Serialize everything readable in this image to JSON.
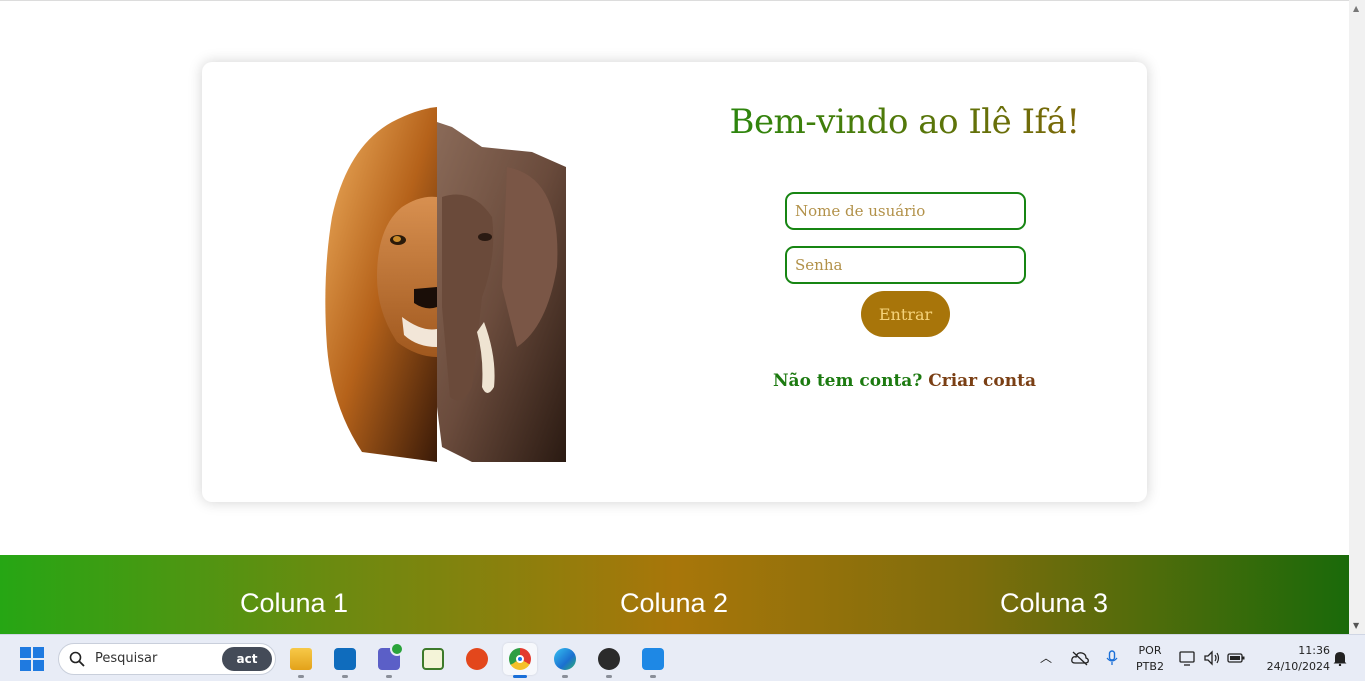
{
  "login": {
    "title": "Bem-vindo ao Ilê Ifá!",
    "username_placeholder": "Nome de usuário",
    "password_placeholder": "Senha",
    "submit_label": "Entrar",
    "signup_question": "Não tem conta?",
    "signup_link": "Criar conta"
  },
  "footer": {
    "columns": [
      "Coluna 1",
      "Coluna 2",
      "Coluna 3"
    ]
  },
  "colors": {
    "title_green": "#1f8a0e",
    "input_border": "#178513",
    "button_bg": "#a8750a",
    "button_text": "#f5d37a",
    "link_brown": "#7a3f14"
  },
  "taskbar": {
    "search_placeholder": "Pesquisar",
    "search_badge": "act",
    "apps": [
      "file-explorer-icon",
      "outlook-icon",
      "teams-icon",
      "notepad-icon",
      "xampp-icon",
      "chrome-icon",
      "edge-icon",
      "obs-icon",
      "vscode-icon"
    ],
    "language_line1": "POR",
    "language_line2": "PTB2",
    "time": "11:36",
    "date": "24/10/2024"
  }
}
